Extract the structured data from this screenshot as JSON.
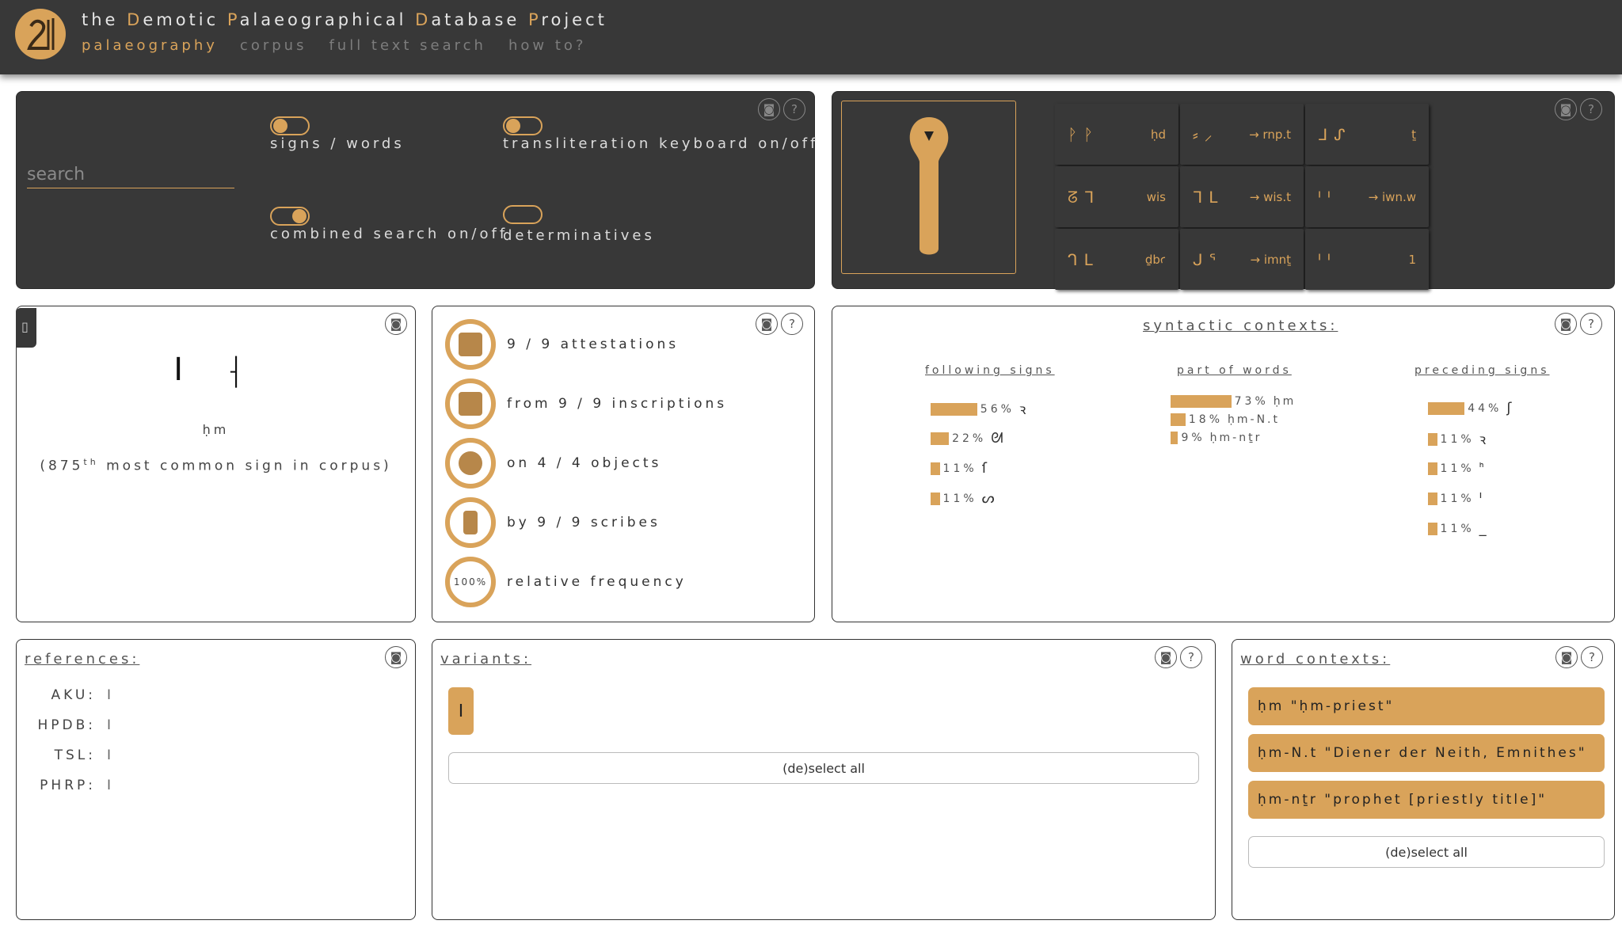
{
  "header": {
    "title_parts": [
      {
        "t": "the ",
        "hl": false
      },
      {
        "t": "D",
        "hl": true
      },
      {
        "t": "emotic ",
        "hl": false
      },
      {
        "t": "P",
        "hl": true
      },
      {
        "t": "alaeographical ",
        "hl": false
      },
      {
        "t": "D",
        "hl": true
      },
      {
        "t": "atabase ",
        "hl": false
      },
      {
        "t": "P",
        "hl": true
      },
      {
        "t": "roject",
        "hl": false
      }
    ],
    "nav": [
      {
        "label": "palaeography",
        "active": true
      },
      {
        "label": "corpus",
        "active": false
      },
      {
        "label": "full text search",
        "active": false
      },
      {
        "label": "how to?",
        "active": false
      }
    ]
  },
  "search_panel": {
    "placeholder": "search",
    "toggles": {
      "signs_words": {
        "label": "signs / words",
        "on": false
      },
      "translit_keyboard": {
        "label": "transliteration keyboard on/off",
        "on": false
      },
      "combined": {
        "label": "combined search on/off",
        "on": true
      },
      "determinatives": {
        "label": "determinatives",
        "on": null
      }
    }
  },
  "sign_grid": [
    {
      "glyphs": "ᚹᚹ",
      "translit": "ḥd"
    },
    {
      "glyphs": "⸗⸝",
      "translit": "→ rnp.t"
    },
    {
      "glyphs": "ᒧᔑ",
      "translit": "ṯ"
    },
    {
      "glyphs": "ᘔᒣ",
      "translit": "wis"
    },
    {
      "glyphs": "ᒣᒪ",
      "translit": "→ wis.t"
    },
    {
      "glyphs": "ᑊᑊ",
      "translit": "→ iwn.w"
    },
    {
      "glyphs": "ᒉᒪ",
      "translit": "ḏbꜥ"
    },
    {
      "glyphs": "ᒍᕐ",
      "translit": "→ imnṯ"
    },
    {
      "glyphs": "ᑊᑊ",
      "translit": "1"
    }
  ],
  "sign_info": {
    "glyphs": "ⵏ ⸡",
    "translit": "ḥm",
    "rank_prefix": "(875",
    "rank_sup": "th",
    "rank_suffix": " most common sign in corpus)"
  },
  "stats": {
    "attestations": "9 / 9 attestations",
    "inscriptions": "from 9 / 9 inscriptions",
    "objects": "on 4 / 4 objects",
    "scribes": "by 9 / 9 scribes",
    "frequency_pct": "100%",
    "frequency_label": "relative frequency"
  },
  "syntactic": {
    "title": "syntactic contexts:",
    "following_title": "following signs",
    "words_title": "part of words",
    "preceding_title": "preceding signs",
    "following": [
      {
        "pct": 56,
        "label": "56%",
        "glyph": "ꝛ"
      },
      {
        "pct": 22,
        "label": "22%",
        "glyph": "ᘛ"
      },
      {
        "pct": 11,
        "label": "11%",
        "glyph": "ſ"
      },
      {
        "pct": 11,
        "label": "11%",
        "glyph": "ᔕ"
      }
    ],
    "words": [
      {
        "pct": 73,
        "label": "73%",
        "text": "ḥm"
      },
      {
        "pct": 18,
        "label": "18%",
        "text": "ḥm-N.t"
      },
      {
        "pct": 9,
        "label": "9%",
        "text": "ḥm-nṯr"
      }
    ],
    "preceding": [
      {
        "pct": 44,
        "label": "44%",
        "glyph": "ʃ"
      },
      {
        "pct": 11,
        "label": "11%",
        "glyph": "ꝛ"
      },
      {
        "pct": 11,
        "label": "11%",
        "glyph": "ᑋ"
      },
      {
        "pct": 11,
        "label": "11%",
        "glyph": "ᑊ"
      },
      {
        "pct": 11,
        "label": "11%",
        "glyph": "_"
      }
    ]
  },
  "references": {
    "title": "references:",
    "rows": [
      {
        "key": "AKU:",
        "value": "ⵏ"
      },
      {
        "key": "HPDB:",
        "value": "ⵏ"
      },
      {
        "key": "TSL:",
        "value": "ⵏ"
      },
      {
        "key": "PHRP:",
        "value": "ⵏ"
      }
    ]
  },
  "variants": {
    "title": "variants:",
    "item_glyph": "ⵏ",
    "deselect": "(de)select all"
  },
  "word_contexts": {
    "title": "word contexts:",
    "items": [
      "ḥm \"ḥm-priest\"",
      "ḥm-N.t \"Diener der Neith, Emnithes\"",
      "ḥm-nṯr \"prophet [priestly title]\""
    ],
    "deselect": "(de)select all"
  }
}
